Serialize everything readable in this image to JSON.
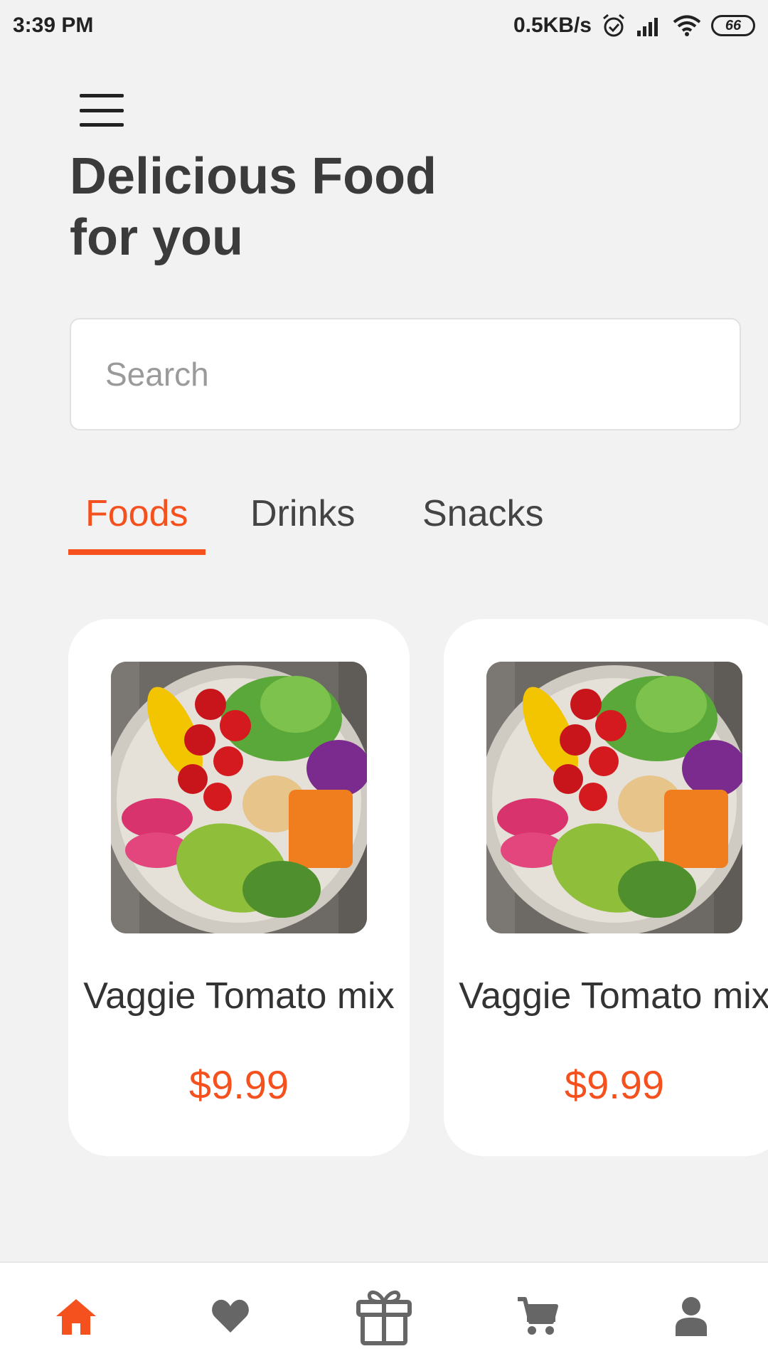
{
  "status_bar": {
    "time": "3:39 PM",
    "network_speed": "0.5KB/s",
    "battery": "66"
  },
  "header": {
    "menu_icon": "hamburger-menu-icon",
    "title_line1": "Delicious Food",
    "title_line2": "for you"
  },
  "search": {
    "placeholder": "Search"
  },
  "tabs": [
    {
      "label": "Foods",
      "active": true
    },
    {
      "label": "Drinks",
      "active": false
    },
    {
      "label": "Snacks",
      "active": false
    }
  ],
  "products": [
    {
      "name": "Vaggie Tomato mix",
      "price": "$9.99",
      "image": "veggie-bowl-image"
    },
    {
      "name": "Vaggie Tomato mix",
      "price": "$9.99",
      "image": "veggie-bowl-image"
    }
  ],
  "bottom_nav": [
    {
      "icon": "home-icon",
      "active": true
    },
    {
      "icon": "heart-icon",
      "active": false
    },
    {
      "icon": "gift-icon",
      "active": false
    },
    {
      "icon": "cart-icon",
      "active": false
    },
    {
      "icon": "profile-icon",
      "active": false
    }
  ],
  "colors": {
    "accent": "#f4511e",
    "background": "#f2f2f2",
    "inactive_icon": "#666666"
  }
}
